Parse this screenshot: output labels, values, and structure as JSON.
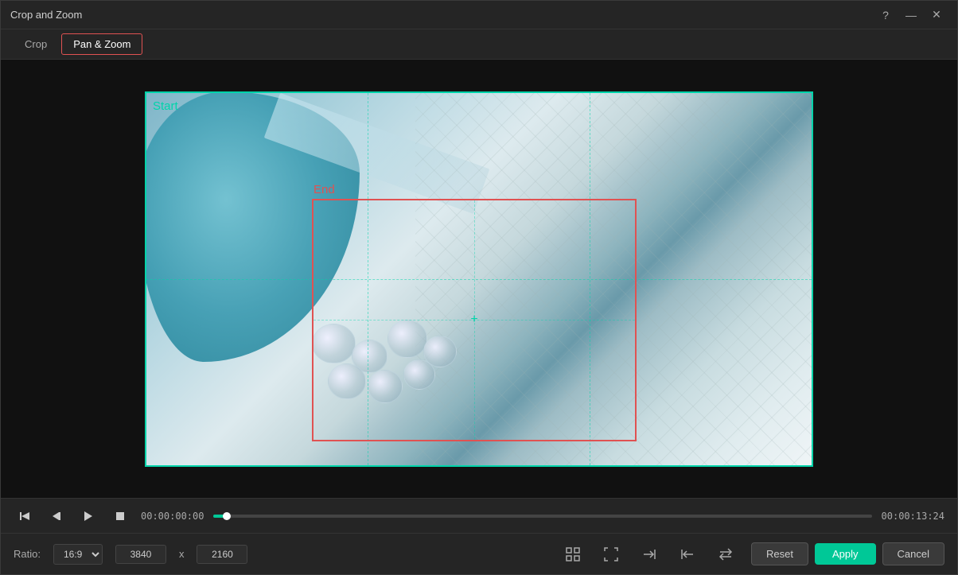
{
  "window": {
    "title": "Crop and Zoom",
    "help_icon": "?",
    "minimize_icon": "—",
    "close_icon": "✕"
  },
  "tabs": {
    "crop_label": "Crop",
    "pan_zoom_label": "Pan & Zoom",
    "active": "pan_zoom"
  },
  "video": {
    "start_label": "Start",
    "end_label": "End"
  },
  "controls": {
    "time_current": "00:00:00:00",
    "time_total": "00:00:13:24"
  },
  "settings": {
    "ratio_label": "Ratio:",
    "ratio_value": "16:9",
    "width": "3840",
    "height": "2160",
    "dim_sep": "x"
  },
  "actions": {
    "reset_label": "Reset",
    "apply_label": "Apply",
    "cancel_label": "Cancel"
  },
  "icons": {
    "step_back": "⏮",
    "frame_back": "◁",
    "play": "▷",
    "stop": "□",
    "fit_screen": "⊡",
    "fullscreen": "⤢",
    "arrow_right": "→",
    "arrow_left": "←",
    "swap": "⇌"
  }
}
